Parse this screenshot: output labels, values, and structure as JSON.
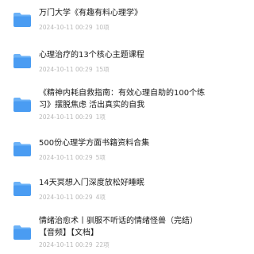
{
  "colors": {
    "folder_body": "#4a9cf2",
    "folder_tab": "#6cb2f7",
    "title_text": "#1a1a1a",
    "meta_text": "#b8b8b8"
  },
  "items": [
    {
      "icon": "folder-icon",
      "title": "万门大学《有趣有料心理学》",
      "date": "2024-10-11 00:29",
      "size": "10项"
    },
    {
      "icon": "folder-icon",
      "title": "心理治疗的13个核心主题课程",
      "date": "2024-10-11 00:29",
      "size": "15项"
    },
    {
      "icon": "folder-icon",
      "title": "《精神内耗自救指南：有效心理自助的100个练习》摆脱焦虑 活出真实的自我",
      "date": "2024-10-11 00:29",
      "size": "1项"
    },
    {
      "icon": "folder-icon",
      "title": "500份心理学方面书籍资料合集",
      "date": "2024-10-11 00:29",
      "size": "5项"
    },
    {
      "icon": "folder-icon",
      "title": "14天冥想入门深度放松好睡眠",
      "date": "2024-10-11 00:29",
      "size": "4项"
    },
    {
      "icon": "folder-icon",
      "title": "情绪治愈术丨驯服不听话的情绪怪兽（完结）【音频】【文档】",
      "date": "2024-10-11 00:29",
      "size": "22项"
    }
  ]
}
